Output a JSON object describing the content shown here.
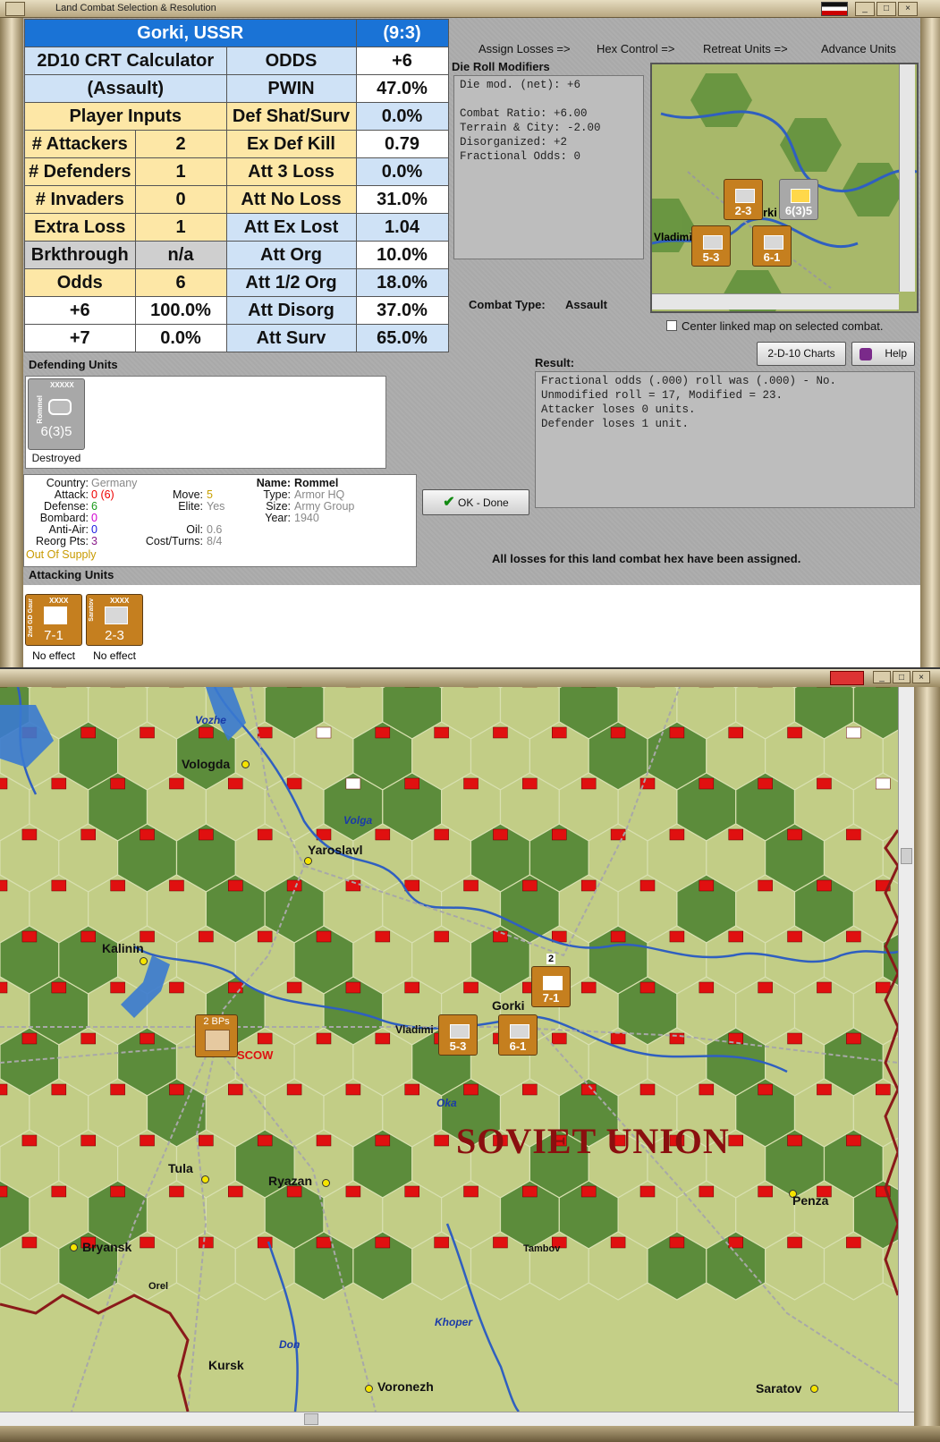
{
  "window": {
    "title": "Land Combat Selection & Resolution"
  },
  "crt": {
    "location": "Gorki, USSR",
    "ratio": "(9:3)",
    "calc_title": "2D10 CRT Calculator",
    "calc_sub": "(Assault)",
    "player_inputs": "Player Inputs",
    "rows_left": [
      {
        "label": "# Attackers",
        "value": "2"
      },
      {
        "label": "# Defenders",
        "value": "1"
      },
      {
        "label": "# Invaders",
        "value": "0"
      },
      {
        "label": "Extra Loss",
        "value": "1"
      },
      {
        "label": "Brkthrough",
        "value": "n/a"
      },
      {
        "label": "Odds",
        "value": "6"
      },
      {
        "label": "+6",
        "value": "100.0%"
      },
      {
        "label": "+7",
        "value": "0.0%"
      }
    ],
    "rows_right": [
      {
        "label": "ODDS",
        "value": "+6"
      },
      {
        "label": "PWIN",
        "value": "47.0%"
      },
      {
        "label": "Def Shat/Surv",
        "value": "0.0%"
      },
      {
        "label": "Ex Def Kill",
        "value": "0.79"
      },
      {
        "label": "Att 3 Loss",
        "value": "0.0%"
      },
      {
        "label": "Att No Loss",
        "value": "31.0%"
      },
      {
        "label": "Att Ex Lost",
        "value": "1.04"
      },
      {
        "label": "Att Org",
        "value": "10.0%"
      },
      {
        "label": "Att 1/2 Org",
        "value": "18.0%"
      },
      {
        "label": "Att Disorg",
        "value": "37.0%"
      },
      {
        "label": "Att Surv",
        "value": "65.0%"
      }
    ]
  },
  "steps": [
    "Assign Losses =>",
    "Hex Control =>",
    "Retreat Units =>",
    "Advance Units"
  ],
  "die_mods": {
    "title": "Die Roll Modifiers",
    "lines": [
      "Die mod. (net): +6",
      "",
      "Combat Ratio: +6.00",
      "Terrain & City: -2.00",
      "Disorganized: +2",
      "Fractional Odds: 0"
    ]
  },
  "combat_type": {
    "label": "Combat Type:",
    "value": "Assault"
  },
  "center_linked": "Center linked map on selected combat.",
  "buttons": {
    "charts": "2-D-10 Charts",
    "help": "Help",
    "ok": "OK - Done"
  },
  "result": {
    "title": "Result:",
    "lines": [
      "Fractional odds (.000) roll was (.000)  - No.",
      "Unmodified roll = 17, Modified = 23.",
      "Attacker loses 0 units.",
      "Defender loses 1 unit."
    ]
  },
  "losses_msg": "All losses for this land combat hex have been assigned.",
  "defending": {
    "title": "Defending Units",
    "unit": {
      "name": "Rommel",
      "size": "XXXXX",
      "str": "6(3)5",
      "status": "Destroyed"
    }
  },
  "unit_info": {
    "country_k": "Country:",
    "country": "Germany",
    "attack_k": "Attack:",
    "attack": "0",
    "attack2": "(6)",
    "defense_k": "Defense:",
    "defense": "6",
    "bombard_k": "Bombard:",
    "bombard": "0",
    "antiair_k": "Anti-Air:",
    "antiair": "0",
    "reorg_k": "Reorg Pts:",
    "reorg": "3",
    "supply": "Out Of Supply",
    "move_k": "Move:",
    "move": "5",
    "elite_k": "Elite:",
    "elite": "Yes",
    "oil_k": "Oil:",
    "oil": "0.6",
    "cost_k": "Cost/Turns:",
    "cost": "8/4",
    "name_k": "Name:",
    "name": "Rommel",
    "type_k": "Type:",
    "type": "Armor HQ",
    "size_k": "Size:",
    "size": "Army Group",
    "year_k": "Year:",
    "year": "1940"
  },
  "attacking": {
    "title": "Attacking Units",
    "units": [
      {
        "name": "2nd GD Gaur",
        "size": "XXXX",
        "str": "7-1",
        "status": "No effect"
      },
      {
        "name": "Saratov",
        "size": "XXXX",
        "str": "2-3",
        "status": "No effect"
      }
    ]
  },
  "minimap": {
    "units": [
      "2-3",
      "6(3)5",
      "5-3",
      "6-1"
    ],
    "labels": [
      "Vladimi",
      "rki"
    ],
    "stack": "2"
  },
  "map": {
    "country": "SOVIET UNION",
    "cities": [
      "Vologda",
      "Yaroslavl",
      "Kalinin",
      "Gorki",
      "Vladimi",
      "Tula",
      "Ryazan",
      "Penza",
      "Bryansk",
      "Tambov",
      "Orel",
      "Kursk",
      "Voronezh",
      "Saratov"
    ],
    "moscow": "SCOW",
    "rivers": [
      "Vozhe",
      "Volga",
      "Oka",
      "Khoper",
      "Don"
    ],
    "units": [
      {
        "str": "7-1"
      },
      {
        "str": "5-3"
      },
      {
        "str": "6-1"
      }
    ],
    "stack": "2",
    "bps": "2 BPs"
  }
}
